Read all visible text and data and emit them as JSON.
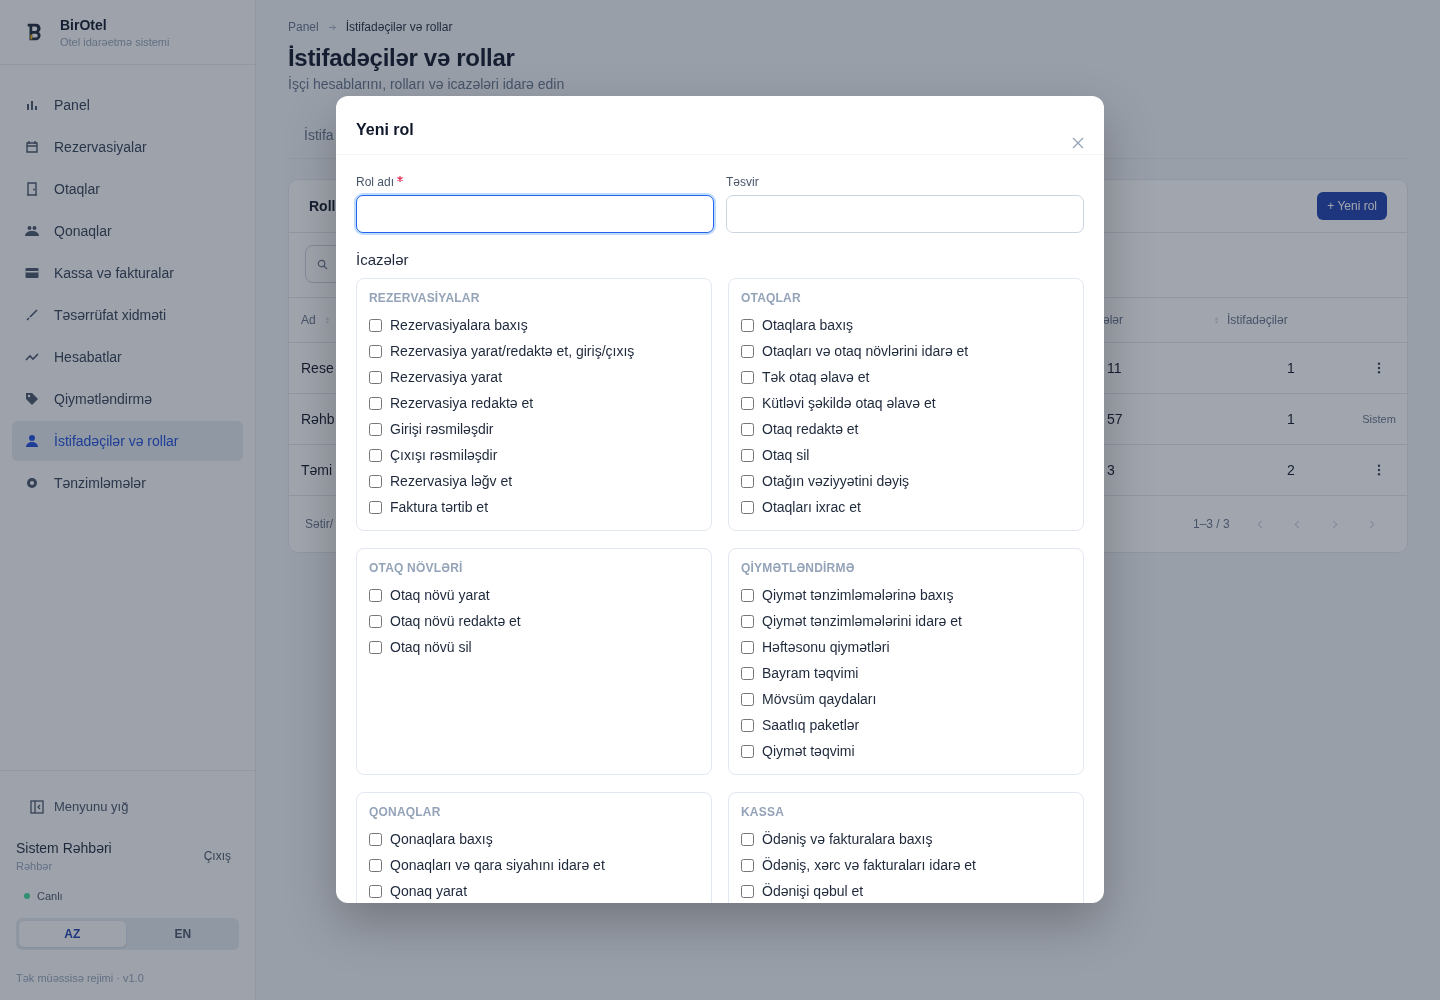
{
  "brand": {
    "name": "BirOtel",
    "tagline": "Otel idarəetmə sistemi"
  },
  "nav": [
    {
      "label": "Panel",
      "selected": false
    },
    {
      "label": "Rezervasiyalar",
      "selected": false
    },
    {
      "label": "Otaqlar",
      "selected": false
    },
    {
      "label": "Qonaqlar",
      "selected": false
    },
    {
      "label": "Kassa və fakturalar",
      "selected": false
    },
    {
      "label": "Təsərrüfat xidməti",
      "selected": false
    },
    {
      "label": "Hesabatlar",
      "selected": false
    },
    {
      "label": "Qiymətləndirmə",
      "selected": false
    },
    {
      "label": "İstifadəçilər və rollar",
      "selected": true
    },
    {
      "label": "Tənzimləmələr",
      "selected": false
    }
  ],
  "collapse": "Menyunu yığ",
  "user": {
    "name": "Sistem Rəhbəri",
    "role": "Rəhbər",
    "logout": "Çıxış"
  },
  "status": {
    "label": "Canlı",
    "color": "#2f8f6f"
  },
  "languages": [
    {
      "label": "AZ",
      "selected": true
    },
    {
      "label": "EN",
      "selected": false
    }
  ],
  "footer": "Tək müəssisə rejimi · v1.0",
  "breadcrumb": [
    "Panel",
    "İstifadəçilər və rollar"
  ],
  "page": {
    "title": "İstifadəçilər və rollar",
    "subtitle": "İşçi hesablarını, rolları və icazələri idarə edin"
  },
  "tab": "İstifa",
  "card": {
    "title": "Roll",
    "new_button": "+ Yeni rol",
    "columns": [
      "Ad",
      "ələr",
      "İstifadəçilər"
    ],
    "rows": [
      {
        "name": "Rese",
        "count": "11",
        "users": "1",
        "kind": "menu"
      },
      {
        "name": "Rəhb",
        "count": "57",
        "users": "1",
        "kind": "system",
        "action_text": "Sistem"
      },
      {
        "name": "Təmi",
        "count": "3",
        "users": "2",
        "kind": "menu"
      }
    ],
    "rows_label": "Sətir/",
    "range": "1–3 / 3"
  },
  "modal": {
    "title": "Yeni rol",
    "fields": [
      {
        "label": "Rol adı",
        "required": true,
        "focused": true
      },
      {
        "label": "Təsvir",
        "required": false,
        "focused": false
      }
    ],
    "permissions_title": "İcazələr",
    "groups": [
      {
        "title": "REZERVASİYALAR",
        "items": [
          {
            "label": "Rezervasiyalara baxış",
            "checked": false
          },
          {
            "label": "Rezervasiya yarat/redaktə et, giriş/çıxış",
            "checked": false
          },
          {
            "label": "Rezervasiya yarat",
            "checked": false
          },
          {
            "label": "Rezervasiya redaktə et",
            "checked": false
          },
          {
            "label": "Girişi rəsmiləşdir",
            "checked": false
          },
          {
            "label": "Çıxışı rəsmiləşdir",
            "checked": false
          },
          {
            "label": "Rezervasiya ləğv et",
            "checked": false
          },
          {
            "label": "Faktura tərtib et",
            "checked": false
          }
        ]
      },
      {
        "title": "OTAQLAR",
        "items": [
          {
            "label": "Otaqlara baxış",
            "checked": false
          },
          {
            "label": "Otaqları və otaq növlərini idarə et",
            "checked": false
          },
          {
            "label": "Tək otaq əlavə et",
            "checked": false
          },
          {
            "label": "Kütləvi şəkildə otaq əlavə et",
            "checked": false
          },
          {
            "label": "Otaq redaktə et",
            "checked": false
          },
          {
            "label": "Otaq sil",
            "checked": false
          },
          {
            "label": "Otağın vəziyyətini dəyiş",
            "checked": false
          },
          {
            "label": "Otaqları ixrac et",
            "checked": false
          }
        ]
      },
      {
        "title": "OTAQ NÖVLƏRİ",
        "items": [
          {
            "label": "Otaq növü yarat",
            "checked": false
          },
          {
            "label": "Otaq növü redaktə et",
            "checked": false
          },
          {
            "label": "Otaq növü sil",
            "checked": false
          }
        ]
      },
      {
        "title": "QİYMƏTLƏNDİRMƏ",
        "items": [
          {
            "label": "Qiymət tənzimləmələrinə baxış",
            "checked": false
          },
          {
            "label": "Qiymət tənzimləmələrini idarə et",
            "checked": false
          },
          {
            "label": "Həftəsonu qiymətləri",
            "checked": false
          },
          {
            "label": "Bayram təqvimi",
            "checked": false
          },
          {
            "label": "Mövsüm qaydaları",
            "checked": false
          },
          {
            "label": "Saatlıq paketlər",
            "checked": false
          },
          {
            "label": "Qiymət təqvimi",
            "checked": false
          }
        ]
      },
      {
        "title": "QONAQLAR",
        "items": [
          {
            "label": "Qonaqlara baxış",
            "checked": false
          },
          {
            "label": "Qonaqları və qara siyahını idarə et",
            "checked": false
          },
          {
            "label": "Qonaq yarat",
            "checked": false
          }
        ]
      },
      {
        "title": "KASSA",
        "items": [
          {
            "label": "Ödəniş və fakturalara baxış",
            "checked": false
          },
          {
            "label": "Ödəniş, xərc və fakturaları idarə et",
            "checked": false
          },
          {
            "label": "Ödənişi qəbul et",
            "checked": false
          }
        ]
      }
    ]
  }
}
